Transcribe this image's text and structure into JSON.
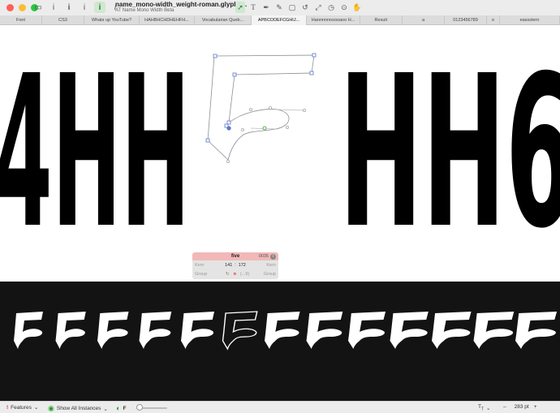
{
  "window": {
    "title": "name_mono-width_weight-roman.glyphs...",
    "subtitle": "AT Name Mono Width Beta"
  },
  "colors": {
    "close": "#ff5f57",
    "minimize": "#febc2e",
    "zoom": "#28c840",
    "accent_green": "#2a9d2a",
    "info_header": "#f2b8b8",
    "preview_bg": "#131313"
  },
  "toolbar": {
    "left_icons": [
      "sidebar-icon",
      "info-i-icon",
      "info-i-bold-icon",
      "info-i-icon",
      "active-i-icon",
      "italic-i-icon"
    ],
    "tools": [
      "select-icon",
      "text-icon",
      "pen-icon",
      "draw-icon",
      "rectangle-icon",
      "rotate-icon",
      "scale-icon",
      "measure-icon",
      "annotate-icon",
      "hand-icon"
    ]
  },
  "tabs": [
    {
      "label": "Font"
    },
    {
      "label": "CS3"
    },
    {
      "label": "Whats up YouTube?"
    },
    {
      "label": "HAHBHCHDHEHFH..."
    },
    {
      "label": "Vocabularian Queb..."
    },
    {
      "label": "APBCODEFCGHIJ..."
    },
    {
      "label": "Hannnnnosooaoo H..."
    },
    {
      "label": "Resulr"
    },
    {
      "label": "a"
    },
    {
      "label": "0123456789"
    },
    {
      "label": "×"
    },
    {
      "label": "eassstern"
    }
  ],
  "canvas": {
    "text_left": "4HH",
    "text_right": "HH6"
  },
  "glyph_info": {
    "name": "five",
    "unicode": "0035",
    "kern_label": "Kern",
    "kern_left": "141",
    "kern_right": "172",
    "group_label": "Group",
    "group_value": "n",
    "group_extra": "(...9)"
  },
  "preview": {
    "glyph_count": 13,
    "highlighted_index": 5
  },
  "status": {
    "features_label": "Features",
    "instances_label": "Show All Instances",
    "f_label": "F",
    "zoom": "283 pt"
  }
}
